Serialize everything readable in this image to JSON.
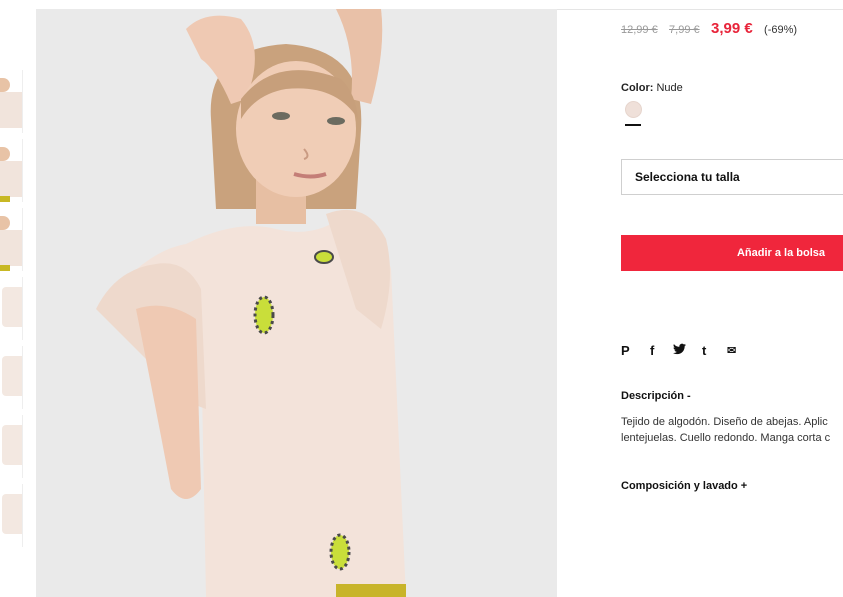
{
  "product": {
    "old_price_1": "12,99 €",
    "old_price_2": "7,99 €",
    "current_price": "3,99 €",
    "discount": "(-69%)",
    "color_label": "Color:",
    "color_value": "Nude",
    "size_placeholder": "Selecciona tu talla",
    "add_to_bag": "Añadir a la bolsa"
  },
  "social": {
    "pinterest": "P",
    "facebook": "f",
    "twitter": "🐦",
    "tumblr": "t",
    "email": "✉"
  },
  "description": {
    "title": "Descripción -",
    "line1": "Tejido de algodón. Diseño de abejas. Aplic",
    "line2": "lentejuelas. Cuello redondo. Manga corta c"
  },
  "composition": {
    "title": "Composición y lavado +"
  },
  "colors": {
    "price_red": "#e8243a",
    "button_red": "#f0263c",
    "swatch_nude": "#efe0d9"
  }
}
